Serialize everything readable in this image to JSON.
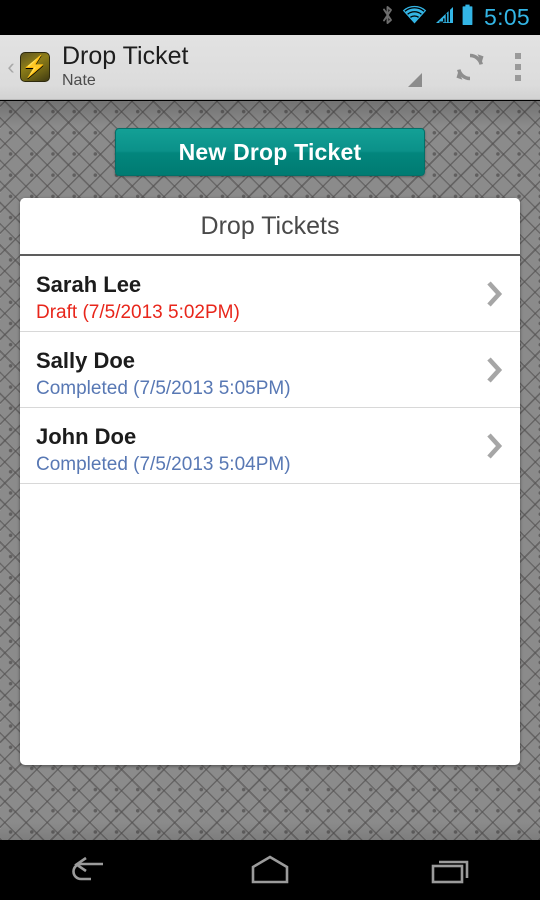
{
  "statusbar": {
    "icons": [
      "bluetooth-icon",
      "wifi-icon",
      "cellular-signal-icon",
      "battery-icon"
    ],
    "clock": "5:05",
    "clock_color": "#33b5e5"
  },
  "actionbar": {
    "up_caret": "‹",
    "app_icon": "lightning-bolt-app-icon",
    "bolt_glyph": "⚡",
    "title": "Drop Ticket",
    "subtitle": "Nate",
    "spinner_indicator": "spinner-triangle-icon",
    "refresh_label": "refresh-icon",
    "overflow_label": "overflow-menu-icon"
  },
  "main": {
    "new_ticket_button": "New Drop Ticket",
    "card_title": "Drop Tickets",
    "tickets": [
      {
        "name": "Sarah Lee",
        "status": "Draft (7/5/2013 5:02PM)",
        "status_color": "#e8261b"
      },
      {
        "name": "Sally Doe",
        "status": "Completed (7/5/2013 5:05PM)",
        "status_color": "#5878b4"
      },
      {
        "name": "John Doe",
        "status": "Completed (7/5/2013 5:04PM)",
        "status_color": "#5878b4"
      }
    ]
  },
  "navbar": {
    "back": "back-icon",
    "home": "home-icon",
    "recents": "recents-icon"
  },
  "colors": {
    "accent_teal": "#0b9189",
    "wallpaper_gray": "#8b8b8b",
    "card_white": "#ffffff"
  }
}
